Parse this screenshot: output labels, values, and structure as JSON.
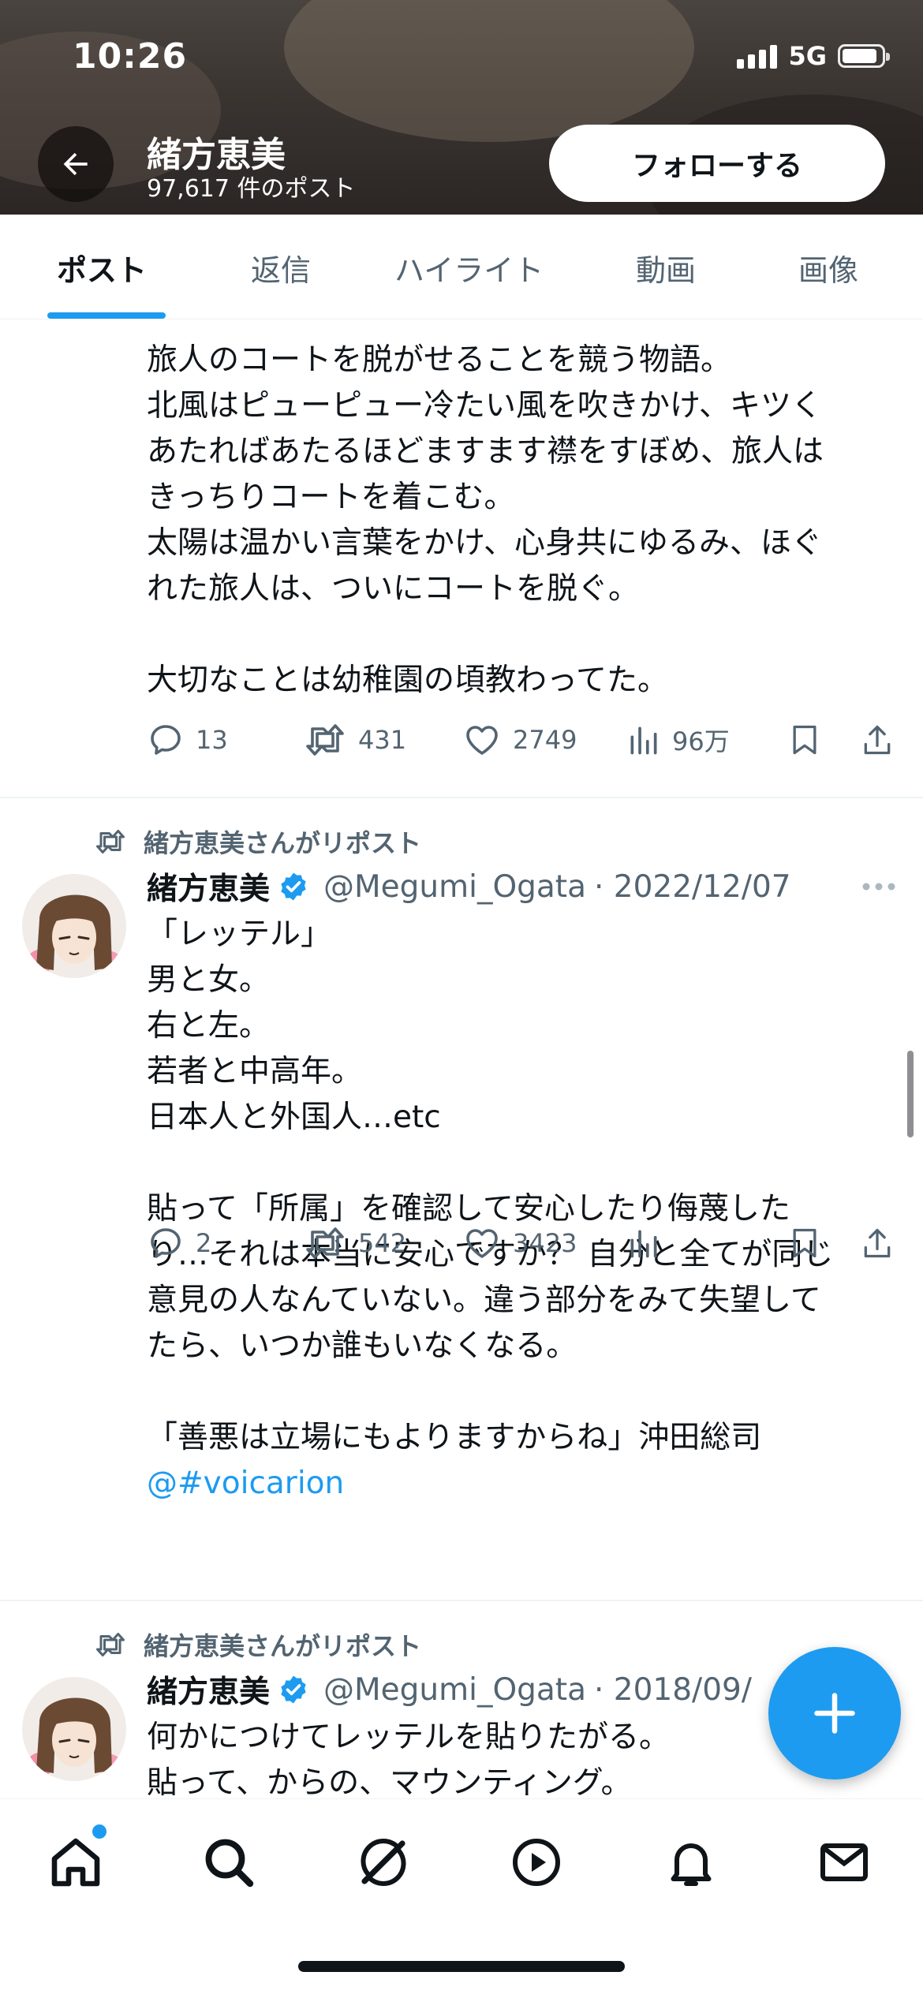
{
  "status_bar": {
    "time": "10:26",
    "network": "5G"
  },
  "profile_header": {
    "name": "緒方恵美",
    "post_count": "97,617 件のポスト",
    "follow_label": "フォローする"
  },
  "tabs": [
    {
      "label": "ポスト",
      "active": true
    },
    {
      "label": "返信",
      "active": false
    },
    {
      "label": "ハイライト",
      "active": false
    },
    {
      "label": "動画",
      "active": false
    },
    {
      "label": "画像",
      "active": false
    }
  ],
  "tweets": [
    {
      "text": "旅人のコートを脱がせることを競う物語。\n北風はピューピュー冷たい風を吹きかけ、キツく\nあたればあたるほどますます襟をすぼめ、旅人は\nきっちりコートを着こむ。\n太陽は温かい言葉をかけ、心身共にゆるみ、ほぐ\nれた旅人は、ついにコートを脱ぐ。\n\n大切なことは幼稚園の頃教わってた。",
      "replies": "13",
      "reposts": "431",
      "likes": "2749",
      "views": "96万"
    },
    {
      "repost_label": "緒方恵美さんがリポスト",
      "author": "緒方恵美",
      "handle": "@Megumi_Ogata",
      "date": "· 2022/12/07",
      "text_main": "「レッテル」\n男と女。\n右と左。\n若者と中高年。\n日本人と外国人…etc\n\n貼って「所属」を確認して安心したり侮蔑した\nり…それは本当に安心ですか？ 自分と全てが同じ\n意見の人なんていない。違う部分をみて失望して\nたら、いつか誰もいなくなる。\n\n「善悪は立場にもよりますからね」沖田総司",
      "mention_prefix": "@",
      "hashtag": "#voicarion",
      "replies": "2",
      "reposts": "542",
      "likes": "3423"
    },
    {
      "repost_label": "緒方恵美さんがリポスト",
      "author": "緒方恵美",
      "handle": "@Megumi_Ogata",
      "date": "· 2018/09/",
      "text": "何かにつけてレッテルを貼りたがる。\n貼って、からの、マウンティング。"
    }
  ],
  "icons": {
    "back": "arrow-left-icon",
    "reply": "speech-bubble-icon",
    "repost": "repost-icon",
    "like": "heart-icon",
    "views": "bar-chart-icon",
    "bookmark": "bookmark-icon",
    "share": "share-icon",
    "verified": "verified-badge-icon",
    "fab": "plus-icon"
  },
  "bottom_nav": [
    "home",
    "search",
    "grok",
    "video",
    "notifications",
    "messages"
  ],
  "colors": {
    "accent": "#1d9bf0",
    "text": "#0f1419",
    "muted": "#536471"
  }
}
